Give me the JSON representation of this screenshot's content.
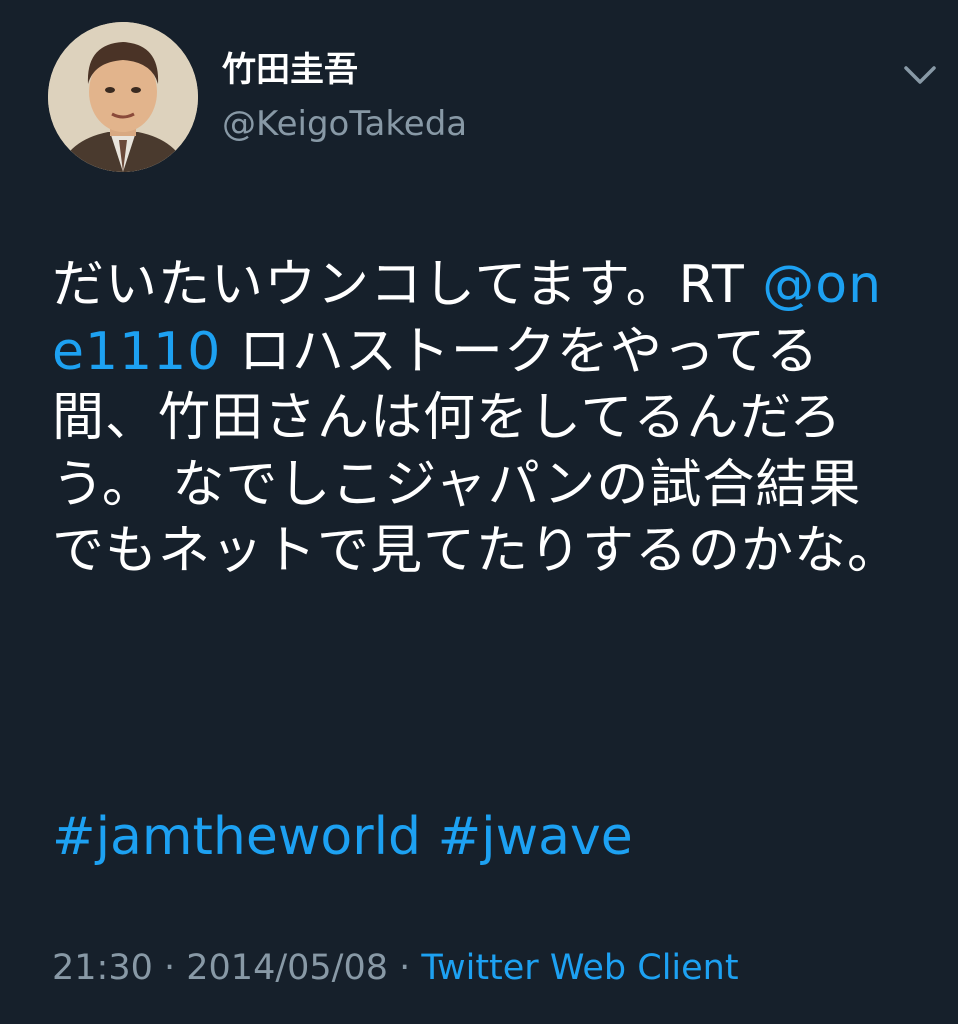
{
  "user": {
    "display_name": "竹田圭吾",
    "handle": "@KeigoTakeda",
    "avatar_icon": "avatar-portrait-icon"
  },
  "menu": {
    "caret_icon": "chevron-down-icon"
  },
  "tweet": {
    "text_1": "だいたいウンコしてます。RT ",
    "mention": "@one1110",
    "text_2": " ロハストークをやってる間、竹田さんは何をしてるんだろう。 なでしこジャパンの試合結果でもネットで見てたりするのかな。",
    "hashtag_1": "#jamtheworld",
    "hashtag_2": "#jwave"
  },
  "meta": {
    "time": "21:30",
    "separator_1": " · ",
    "date": "2014/05/08",
    "separator_2": " · ",
    "source": "Twitter Web Client"
  },
  "colors": {
    "background": "#16202b",
    "link": "#1da1f2",
    "secondary_text": "#8899a6",
    "primary_text": "#ffffff"
  }
}
